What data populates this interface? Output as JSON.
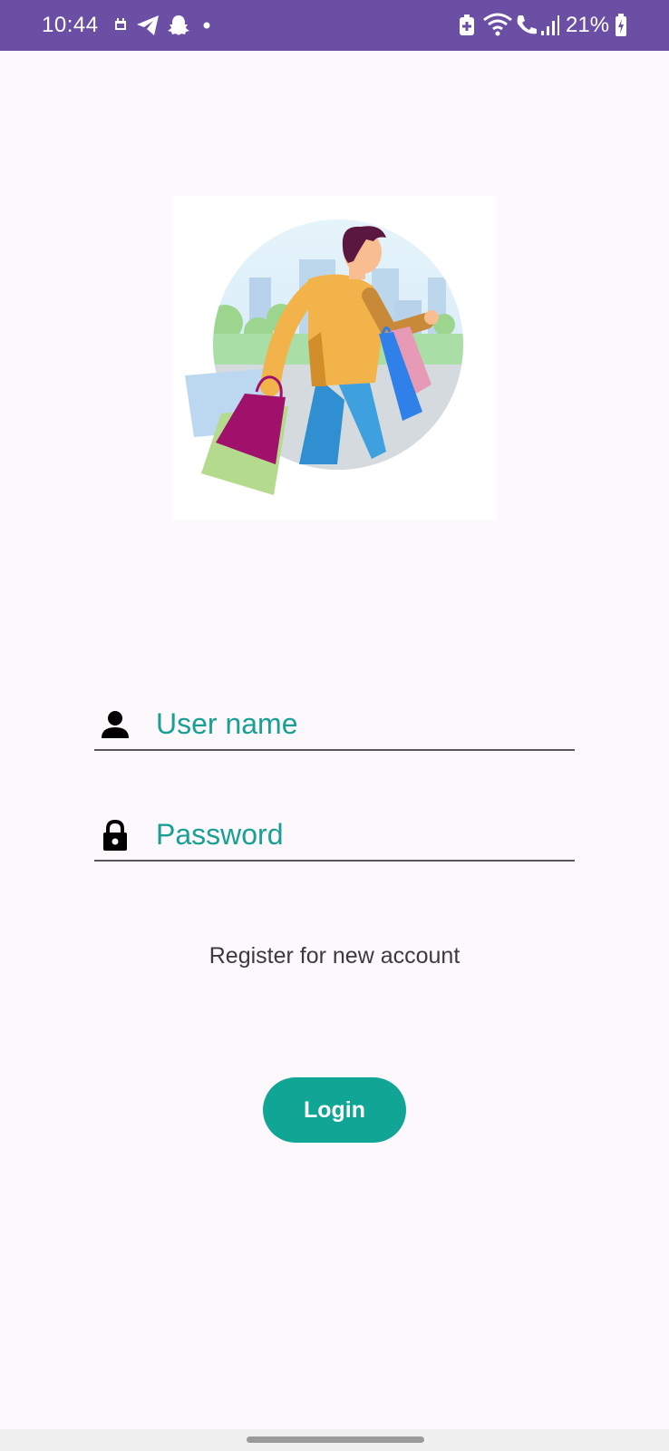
{
  "status_bar": {
    "time": "10:44",
    "battery_text": "21%",
    "background": "#6a4fa4",
    "left_icons": [
      "calendar-icon",
      "telegram-icon",
      "snapchat-icon",
      "dot-icon"
    ],
    "right_icons": [
      "battery-saver-icon",
      "wifi-icon",
      "wifi-call-icon",
      "signal-icon",
      "battery-icon"
    ]
  },
  "hero": {
    "illustration": "shopping-man-illustration"
  },
  "form": {
    "username": {
      "placeholder": "User name",
      "value": "",
      "icon": "person-icon"
    },
    "password": {
      "placeholder": "Password",
      "value": "",
      "icon": "lock-icon"
    },
    "accent_color": "#19a094"
  },
  "register_link": "Register for new account",
  "login_button": {
    "label": "Login",
    "color": "#10a594"
  }
}
